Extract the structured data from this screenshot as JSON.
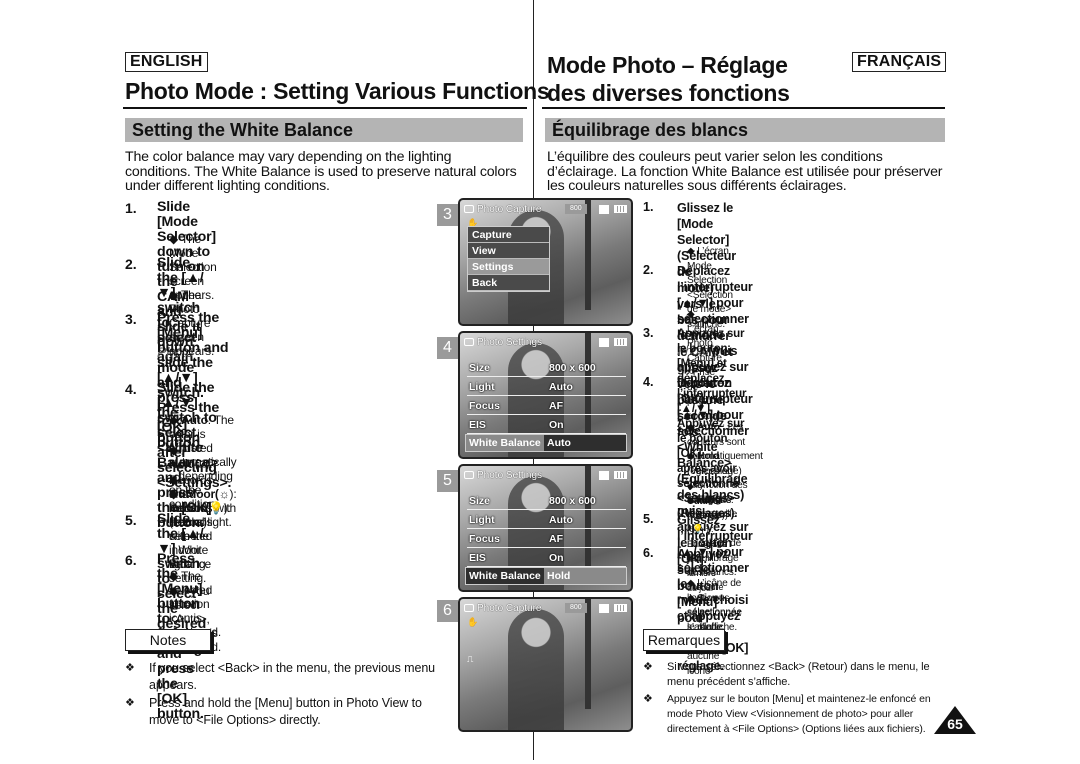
{
  "header": {
    "en_lang": "ENGLISH",
    "fr_lang": "FRANÇAIS",
    "en_title": "Photo Mode : Setting Various Functions",
    "fr_title_line1": "Mode Photo – Réglage",
    "fr_title_line2": "des diverses fonctions"
  },
  "en": {
    "section": "Setting the White Balance",
    "intro": [
      "The color balance may vary depending on the lighting",
      "conditions. The White Balance is used to preserve natural colors",
      "under different lighting conditions."
    ],
    "steps": [
      {
        "num": "1.",
        "title": [
          "Slide [Mode Selector] down to turn on the",
          "CAM and slide it down again."
        ],
        "subs": [
          "◆ The Mode Selection screen appears."
        ]
      },
      {
        "num": "2.",
        "title_a": "Slide the [▲/▼] switch to select ",
        "title_italic": "Photo",
        "title_b": "mode and press the [OK] button.",
        "subs": [
          "◆ The Photo Capture screen appears."
        ]
      },
      {
        "num": "3.",
        "title": [
          "Press the [Menu] button and slide the",
          "[▲/▼] switch.",
          "Press the [OK] button after selecting",
          "<Settings>."
        ]
      },
      {
        "num": "4.",
        "title": [
          "Slide the [▲/▼] switch to select <White",
          "Balance> and press the [OK] button."
        ],
        "options": [
          {
            "name": "Auto",
            "desc": ": The color is adjusted automatically",
            "desc2": "depending on the condition."
          },
          {
            "name": "Hold(",
            "icon": "hold-icon",
            "desc": "): Records and holds (Locks) selected",
            "desc2": "White Balance setting."
          },
          {
            "name": "Outdoor(",
            "icon": "outdoor-icon",
            "desc": "): Records with natural light."
          },
          {
            "name": "Indoor(",
            "icon": "indoor-icon",
            "desc": "): Records with the indoor lighting."
          }
        ]
      },
      {
        "num": "5.",
        "title": [
          "Slide the [▲/▼] switch to select the",
          "desired setting and press the [OK] button."
        ]
      },
      {
        "num": "6.",
        "title": [
          "Press the [Menu] button to finish setting."
        ],
        "subs": [
          "◆ The selected function icon is displayed.",
          "◆ If you select <Auto>, no icon is displayed."
        ]
      }
    ],
    "notes_label": "Notes",
    "notes": [
      [
        "If you select <Back> in the menu, the previous menu",
        "appears."
      ],
      [
        "Press and hold the [Menu] button in Photo View to",
        "move to <File Options> directly."
      ]
    ]
  },
  "fr": {
    "section": "Équilibrage des blancs",
    "intro": [
      "L’équilibre des couleurs peut varier selon les conditions",
      "d’éclairage. La fonction White Balance est utilisée pour préserver",
      "les couleurs naturelles sous différents éclairages."
    ],
    "steps": [
      {
        "num": "1.",
        "title": [
          "Glissez le [Mode Selector] (Sélecteur de",
          "mode) vers le bas pour démarrer le CAM et",
          "glissez vers le bas une seconde fois."
        ],
        "subs": [
          "◆ L’écran Mode Selection <Sélection de mode> s’affiche."
        ]
      },
      {
        "num": "2.",
        "title_a": "Déplacez l’interrupteur [▲/▼] pour",
        "title_b1": "sélectionner le mode ",
        "title_italic": "Photo",
        "title_b2": " puis appuyez sur",
        "title_c": "le bouton [OK].",
        "subs": [
          "◆ L’écran Photo Capture <Prise de photo> apparaît."
        ]
      },
      {
        "num": "3.",
        "title": [
          "Appuyez sur le bouton [Menu] et déplacez",
          "l’interrupteur [▲/▼]. Appuyez sur le bouton [OK]",
          "après avoir sélectionné <Settings> (Réglages)."
        ]
      },
      {
        "num": "4.",
        "title": [
          "Déplacez l’interrupteur [▲/▼] pour",
          "sélectionner <White Balance> (Équilibrage",
          "des blancs) puis appuyez sur le bouton [OK]."
        ],
        "options": [
          {
            "name": "Auto",
            "desc": " : Les couleurs sont automatiquement réglées en",
            "desc2": "fonction des conditions."
          },
          {
            "name": "Hold",
            "paren": " (Verouillage) ( ",
            "icon": "hold-icon",
            "desc": ") : Enregistre et verrouille le",
            "desc2": "réglage de l'équilibrage des blancs."
          },
          {
            "name": "Outdoor",
            "paren": " (Extérieur) ( ",
            "icon": "outdoor-icon",
            "desc": ") : Enregistre à la lumière du jour"
          },
          {
            "name": "Indoor",
            "paren": " (Intérieur) ( ",
            "icon": "indoor-icon",
            "desc": " ) : Enregistre à la lumière intérieure"
          }
        ]
      },
      {
        "num": "5.",
        "title": [
          "Glissez l’interrupteur [▲/▼] pour sélectionner le",
          "mode choisi et appuyez sur le bouton [OK]"
        ]
      },
      {
        "num": "6.",
        "title": [
          "Appuyez sur le bouton [Menu] pour terminer",
          "le réglage."
        ],
        "subs": [
          "◆ L’icône de l’option sélectionnée s’affiche.",
          "◆ Si vous sélectionnez le mode <Auto>, aucune icône",
          "ne s’affiche."
        ]
      }
    ],
    "notes_label": "Remarques",
    "notes": [
      [
        "Si vous sélectionnez <Back> (Retour) dans le menu, le",
        "menu précédent s’affiche."
      ],
      [
        "Appuyez sur le bouton [Menu] et maintenez-le enfoncé en",
        "mode Photo View <Visionnement de photo> pour aller",
        "directement à <File Options> (Options liées aux fichiers)."
      ]
    ]
  },
  "screens": [
    {
      "step": "3",
      "header": "Photo Capture",
      "resolution": "800",
      "menu": [
        "Capture",
        "View",
        "Settings",
        "Back"
      ],
      "selected": "Settings"
    },
    {
      "step": "4",
      "header": "Photo Settings",
      "rows": [
        [
          "Size",
          "800 x 600"
        ],
        [
          "Light",
          "Auto"
        ],
        [
          "Focus",
          "AF"
        ],
        [
          "EIS",
          "On"
        ]
      ],
      "wb_label": "White Balance",
      "wb_value": "Auto"
    },
    {
      "step": "5",
      "header": "Photo Settings",
      "rows": [
        [
          "Size",
          "800 x 600"
        ],
        [
          "Light",
          "Auto"
        ],
        [
          "Focus",
          "AF"
        ],
        [
          "EIS",
          "On"
        ]
      ],
      "wb_label": "White Balance",
      "wb_value": "Hold"
    },
    {
      "step": "6",
      "header": "Photo Capture",
      "resolution": "800"
    }
  ],
  "page_number": "65"
}
